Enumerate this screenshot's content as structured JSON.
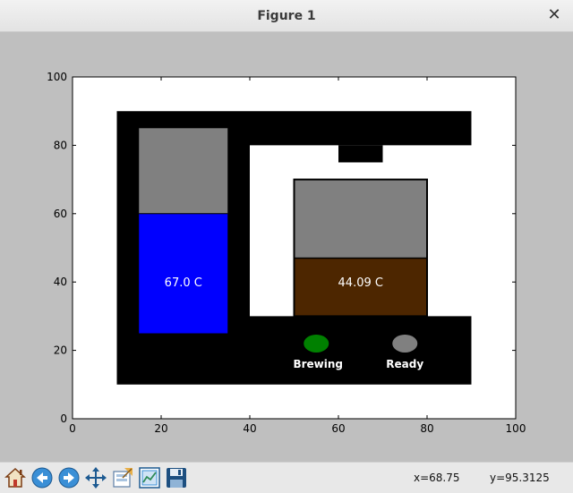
{
  "window": {
    "title": "Figure 1",
    "close_glyph": "✕"
  },
  "toolbar": {
    "buttons": [
      "home-icon",
      "back-icon",
      "forward-icon",
      "pan-icon",
      "configure-subplots-icon",
      "zoom-to-rect-icon",
      "save-icon"
    ],
    "coords": {
      "x": "x=68.75",
      "y": "y=95.3125"
    }
  },
  "scene": {
    "tank_left_label": "67.0 C",
    "tank_right_label": "44.09 C",
    "indicator_brewing": "Brewing",
    "indicator_ready": "Ready",
    "colors": {
      "machine_body": "#000000",
      "tank_empty": "#808080",
      "water": "#0000ff",
      "coffee": "#4d2600",
      "indicator_brewing_on": "#008000",
      "indicator_ready_off": "#808080"
    }
  },
  "chart_data": {
    "type": "other",
    "xlim": [
      0,
      100
    ],
    "ylim": [
      0,
      100
    ],
    "xticks": [
      "0",
      "20",
      "40",
      "60",
      "80",
      "100"
    ],
    "yticks": [
      "0",
      "20",
      "40",
      "60",
      "80",
      "100"
    ],
    "tank_left": {
      "x": [
        15,
        35
      ],
      "y": [
        25,
        85
      ],
      "level": 60,
      "temperature": "67.0 C"
    },
    "tank_right": {
      "x": [
        50,
        80
      ],
      "y": [
        30,
        70
      ],
      "level": 47,
      "temperature": "44.09 C"
    },
    "indicators": [
      {
        "name": "Brewing",
        "x": 55,
        "y": 22,
        "state": "on"
      },
      {
        "name": "Ready",
        "x": 75,
        "y": 22,
        "state": "off"
      }
    ]
  }
}
